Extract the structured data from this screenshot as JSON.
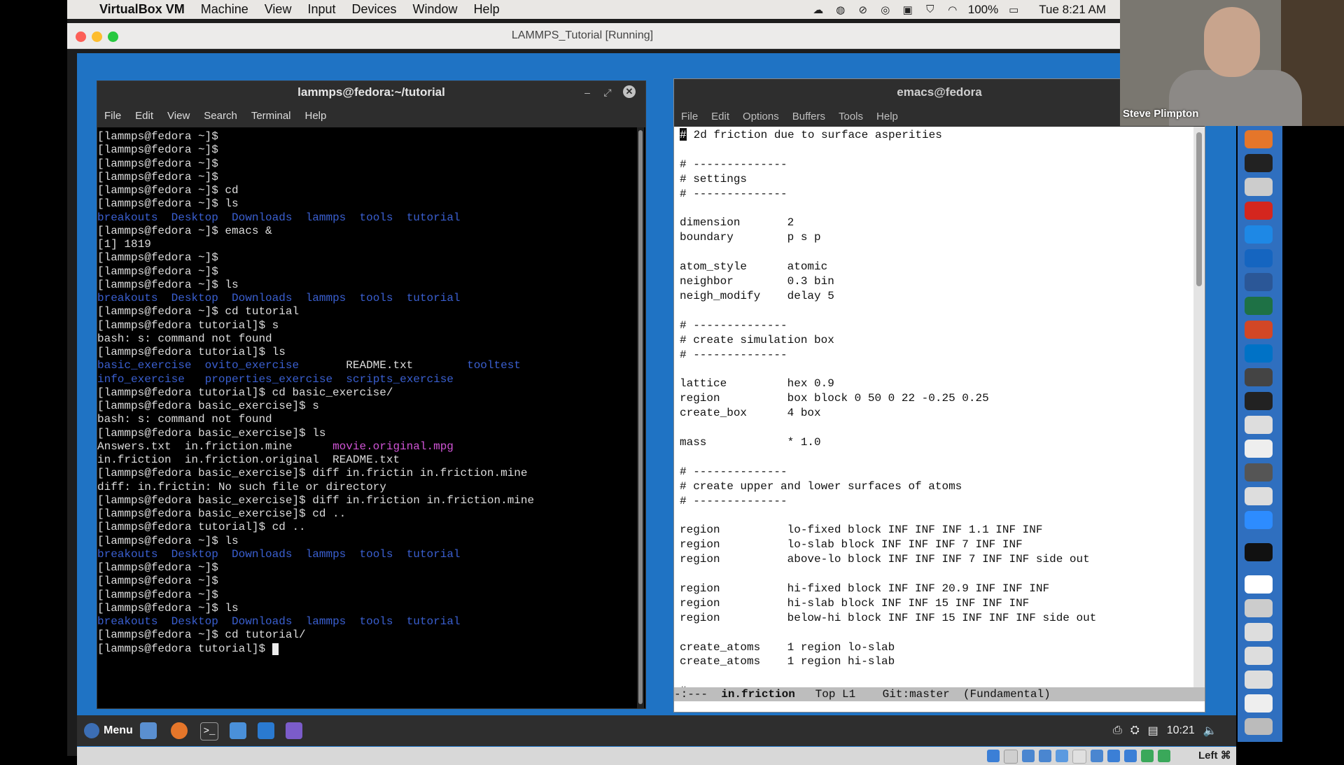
{
  "mac_menubar": {
    "app": "VirtualBox VM",
    "items": [
      "Machine",
      "View",
      "Input",
      "Devices",
      "Window",
      "Help"
    ],
    "battery": "100%",
    "clock": "Tue 8:21 AM"
  },
  "vbox_window": {
    "title": "LAMMPS_Tutorial [Running]"
  },
  "terminal": {
    "title": "lammps@fedora:~/tutorial",
    "menu": [
      "File",
      "Edit",
      "View",
      "Search",
      "Terminal",
      "Help"
    ],
    "lines": [
      [
        {
          "t": "[lammps@fedora ~]$ ",
          "c": "n"
        }
      ],
      [
        {
          "t": "[lammps@fedora ~]$ ",
          "c": "n"
        }
      ],
      [
        {
          "t": "[lammps@fedora ~]$ ",
          "c": "n"
        }
      ],
      [
        {
          "t": "[lammps@fedora ~]$ ",
          "c": "n"
        }
      ],
      [
        {
          "t": "[lammps@fedora ~]$ cd",
          "c": "n"
        }
      ],
      [
        {
          "t": "[lammps@fedora ~]$ ls",
          "c": "n"
        }
      ],
      [
        {
          "t": "breakouts",
          "c": "d"
        },
        {
          "t": "  ",
          "c": "n"
        },
        {
          "t": "Desktop",
          "c": "d"
        },
        {
          "t": "  ",
          "c": "n"
        },
        {
          "t": "Downloads",
          "c": "d"
        },
        {
          "t": "  ",
          "c": "n"
        },
        {
          "t": "lammps",
          "c": "d"
        },
        {
          "t": "  ",
          "c": "n"
        },
        {
          "t": "tools",
          "c": "d"
        },
        {
          "t": "  ",
          "c": "n"
        },
        {
          "t": "tutorial",
          "c": "d"
        }
      ],
      [
        {
          "t": "[lammps@fedora ~]$ emacs &",
          "c": "n"
        }
      ],
      [
        {
          "t": "[1] 1819",
          "c": "n"
        }
      ],
      [
        {
          "t": "[lammps@fedora ~]$ ",
          "c": "n"
        }
      ],
      [
        {
          "t": "[lammps@fedora ~]$ ",
          "c": "n"
        }
      ],
      [
        {
          "t": "[lammps@fedora ~]$ ls",
          "c": "n"
        }
      ],
      [
        {
          "t": "breakouts",
          "c": "d"
        },
        {
          "t": "  ",
          "c": "n"
        },
        {
          "t": "Desktop",
          "c": "d"
        },
        {
          "t": "  ",
          "c": "n"
        },
        {
          "t": "Downloads",
          "c": "d"
        },
        {
          "t": "  ",
          "c": "n"
        },
        {
          "t": "lammps",
          "c": "d"
        },
        {
          "t": "  ",
          "c": "n"
        },
        {
          "t": "tools",
          "c": "d"
        },
        {
          "t": "  ",
          "c": "n"
        },
        {
          "t": "tutorial",
          "c": "d"
        }
      ],
      [
        {
          "t": "[lammps@fedora ~]$ cd tutorial",
          "c": "n"
        }
      ],
      [
        {
          "t": "[lammps@fedora tutorial]$ s",
          "c": "n"
        }
      ],
      [
        {
          "t": "bash: s: command not found",
          "c": "n"
        }
      ],
      [
        {
          "t": "[lammps@fedora tutorial]$ ls",
          "c": "n"
        }
      ],
      [
        {
          "t": "basic_exercise",
          "c": "d"
        },
        {
          "t": "  ",
          "c": "n"
        },
        {
          "t": "ovito_exercise",
          "c": "d"
        },
        {
          "t": "       README.txt        ",
          "c": "n"
        },
        {
          "t": "tooltest",
          "c": "d"
        }
      ],
      [
        {
          "t": "info_exercise",
          "c": "d"
        },
        {
          "t": "   ",
          "c": "n"
        },
        {
          "t": "properties_exercise",
          "c": "d"
        },
        {
          "t": "  ",
          "c": "n"
        },
        {
          "t": "scripts_exercise",
          "c": "d"
        }
      ],
      [
        {
          "t": "[lammps@fedora tutorial]$ cd basic_exercise/",
          "c": "n"
        }
      ],
      [
        {
          "t": "[lammps@fedora basic_exercise]$ s",
          "c": "n"
        }
      ],
      [
        {
          "t": "bash: s: command not found",
          "c": "n"
        }
      ],
      [
        {
          "t": "[lammps@fedora basic_exercise]$ ls",
          "c": "n"
        }
      ],
      [
        {
          "t": "Answers.txt  in.friction.mine      ",
          "c": "n"
        },
        {
          "t": "movie.original.mpg",
          "c": "v"
        }
      ],
      [
        {
          "t": "in.friction  in.friction.original  README.txt",
          "c": "n"
        }
      ],
      [
        {
          "t": "[lammps@fedora basic_exercise]$ diff in.frictin in.friction.mine",
          "c": "n"
        }
      ],
      [
        {
          "t": "diff: in.frictin: No such file or directory",
          "c": "n"
        }
      ],
      [
        {
          "t": "[lammps@fedora basic_exercise]$ diff in.friction in.friction.mine",
          "c": "n"
        }
      ],
      [
        {
          "t": "[lammps@fedora basic_exercise]$ cd ..",
          "c": "n"
        }
      ],
      [
        {
          "t": "[lammps@fedora tutorial]$ cd ..",
          "c": "n"
        }
      ],
      [
        {
          "t": "[lammps@fedora ~]$ ls",
          "c": "n"
        }
      ],
      [
        {
          "t": "breakouts",
          "c": "d"
        },
        {
          "t": "  ",
          "c": "n"
        },
        {
          "t": "Desktop",
          "c": "d"
        },
        {
          "t": "  ",
          "c": "n"
        },
        {
          "t": "Downloads",
          "c": "d"
        },
        {
          "t": "  ",
          "c": "n"
        },
        {
          "t": "lammps",
          "c": "d"
        },
        {
          "t": "  ",
          "c": "n"
        },
        {
          "t": "tools",
          "c": "d"
        },
        {
          "t": "  ",
          "c": "n"
        },
        {
          "t": "tutorial",
          "c": "d"
        }
      ],
      [
        {
          "t": "[lammps@fedora ~]$ ",
          "c": "n"
        }
      ],
      [
        {
          "t": "[lammps@fedora ~]$ ",
          "c": "n"
        }
      ],
      [
        {
          "t": "[lammps@fedora ~]$ ",
          "c": "n"
        }
      ],
      [
        {
          "t": "[lammps@fedora ~]$ ls",
          "c": "n"
        }
      ],
      [
        {
          "t": "breakouts",
          "c": "d"
        },
        {
          "t": "  ",
          "c": "n"
        },
        {
          "t": "Desktop",
          "c": "d"
        },
        {
          "t": "  ",
          "c": "n"
        },
        {
          "t": "Downloads",
          "c": "d"
        },
        {
          "t": "  ",
          "c": "n"
        },
        {
          "t": "lammps",
          "c": "d"
        },
        {
          "t": "  ",
          "c": "n"
        },
        {
          "t": "tools",
          "c": "d"
        },
        {
          "t": "  ",
          "c": "n"
        },
        {
          "t": "tutorial",
          "c": "d"
        }
      ],
      [
        {
          "t": "[lammps@fedora ~]$ cd tutorial/",
          "c": "n"
        }
      ],
      [
        {
          "t": "[lammps@fedora tutorial]$ ",
          "c": "n"
        },
        {
          "t": "",
          "c": "cursor"
        }
      ]
    ]
  },
  "emacs": {
    "title": "emacs@fedora",
    "menu": [
      "File",
      "Edit",
      "Options",
      "Buffers",
      "Tools",
      "Help"
    ],
    "cursor_char": "#",
    "first_line_rest": " 2d friction due to surface asperities",
    "lines": [
      "",
      "# --------------",
      "# settings",
      "# --------------",
      "",
      "dimension       2",
      "boundary        p s p",
      "",
      "atom_style      atomic",
      "neighbor        0.3 bin",
      "neigh_modify    delay 5",
      "",
      "# --------------",
      "# create simulation box",
      "# --------------",
      "",
      "lattice         hex 0.9",
      "region          box block 0 50 0 22 -0.25 0.25",
      "create_box      4 box",
      "",
      "mass            * 1.0",
      "",
      "# --------------",
      "# create upper and lower surfaces of atoms",
      "# --------------",
      "",
      "region          lo-fixed block INF INF INF 1.1 INF INF",
      "region          lo-slab block INF INF INF 7 INF INF",
      "region          above-lo block INF INF INF 7 INF INF side out",
      "",
      "region          hi-fixed block INF INF 20.9 INF INF INF",
      "region          hi-slab block INF INF 15 INF INF INF",
      "region          below-hi block INF INF 15 INF INF INF side out",
      "",
      "create_atoms    1 region lo-slab",
      "create_atoms    1 region hi-slab",
      "",
      "# --------------"
    ],
    "modeline": {
      "prefix": "-:---  ",
      "buffer": "in.friction",
      "rest": "   Top L1    Git:master  (Fundamental)"
    }
  },
  "taskbar": {
    "menu_label": "Menu",
    "clock": "10:21"
  },
  "vbox_status": {
    "host_key": "Left ⌘"
  },
  "webcam": {
    "name": "Steve Plimpton"
  },
  "colors": {
    "desktop": "#1f73c4",
    "dir": "#3a5fd0",
    "video": "#d054d6"
  }
}
